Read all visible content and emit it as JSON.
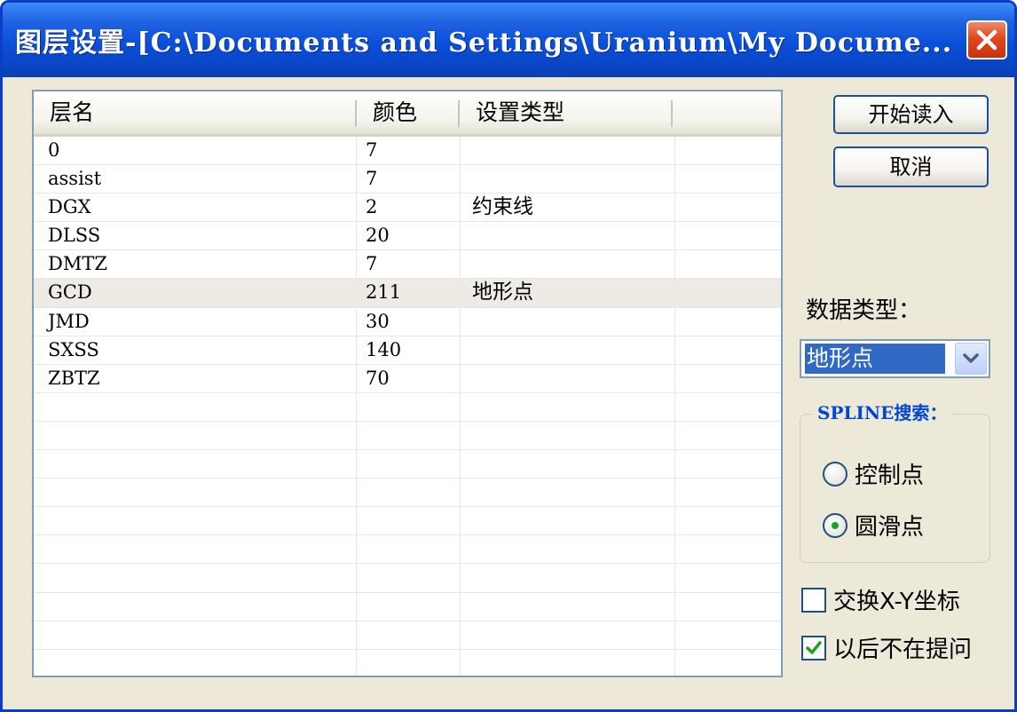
{
  "window": {
    "title": "图层设置-[C:\\Documents and Settings\\Uranium\\My Docume..."
  },
  "list": {
    "columns": [
      "层名",
      "颜色",
      "设置类型"
    ],
    "rows": [
      {
        "name": "0",
        "color": "7",
        "type": ""
      },
      {
        "name": "assist",
        "color": "7",
        "type": ""
      },
      {
        "name": "DGX",
        "color": "2",
        "type": "约束线"
      },
      {
        "name": "DLSS",
        "color": "20",
        "type": ""
      },
      {
        "name": "DMTZ",
        "color": "7",
        "type": ""
      },
      {
        "name": "GCD",
        "color": "211",
        "type": "地形点"
      },
      {
        "name": "JMD",
        "color": "30",
        "type": ""
      },
      {
        "name": "SXSS",
        "color": "140",
        "type": ""
      },
      {
        "name": "ZBTZ",
        "color": "70",
        "type": ""
      }
    ],
    "selected_row": "GCD"
  },
  "buttons": {
    "start_read": "开始读入",
    "cancel": "取消"
  },
  "data_type": {
    "label": "数据类型：",
    "selected": "地形点"
  },
  "spline": {
    "title": "SPLINE搜索：",
    "option_control": "控制点",
    "option_smooth": "圆滑点",
    "selected": "圆滑点"
  },
  "checkboxes": {
    "swap_xy": {
      "label": "交换X-Y坐标",
      "checked": false
    },
    "no_ask": {
      "label": "以后不在提问",
      "checked": true
    }
  },
  "colors": {
    "titlebar": "#0a4fd8",
    "close": "#e0471e",
    "selection": "#316ac5",
    "face": "#ece9d8",
    "group_title": "#0046d5"
  }
}
